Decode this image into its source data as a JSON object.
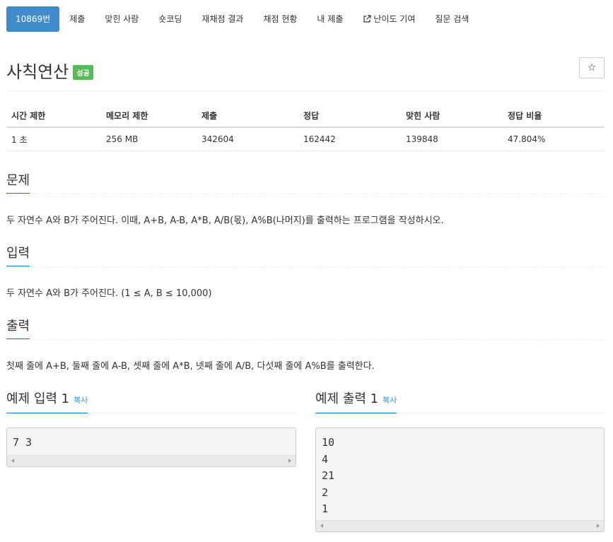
{
  "nav": {
    "tabs": [
      {
        "label": "10869번",
        "active": true
      },
      {
        "label": "제출"
      },
      {
        "label": "맞힌 사람"
      },
      {
        "label": "숏코딩"
      },
      {
        "label": "재채점 결과"
      },
      {
        "label": "채점 현황"
      },
      {
        "label": "내 제출"
      },
      {
        "label": "난이도 기여",
        "icon": "external-link-icon"
      },
      {
        "label": "질문 검색"
      }
    ]
  },
  "problem": {
    "title": "사칙연산",
    "status_badge": "성공",
    "star_icon": "☆"
  },
  "info_table": {
    "headers": [
      "시간 제한",
      "메모리 제한",
      "제출",
      "정답",
      "맞힌 사람",
      "정답 비율"
    ],
    "values": [
      "1 초",
      "256 MB",
      "342604",
      "162442",
      "139848",
      "47.804%"
    ]
  },
  "sections": {
    "description": {
      "heading": "문제",
      "text": "두 자연수 A와 B가 주어진다. 이때, A+B, A-B, A*B, A/B(몫), A%B(나머지)를 출력하는 프로그램을 작성하시오."
    },
    "input": {
      "heading": "입력",
      "text": "두 자연수 A와 B가 주어진다. (1 ≤ A, B ≤ 10,000)"
    },
    "output": {
      "heading": "출력",
      "text": "첫째 줄에 A+B, 둘째 줄에 A-B, 셋째 줄에 A*B, 넷째 줄에 A/B, 다섯째 줄에 A%B를 출력한다."
    }
  },
  "samples": {
    "input": {
      "heading": "예제 입력 1",
      "copy_label": "복사",
      "content": "7 3"
    },
    "output": {
      "heading": "예제 출력 1",
      "copy_label": "복사",
      "content": "10\n4\n21\n2\n1"
    }
  },
  "colors": {
    "accent": "#428bca",
    "success": "#5cb85c",
    "underline": "#0078d7"
  }
}
